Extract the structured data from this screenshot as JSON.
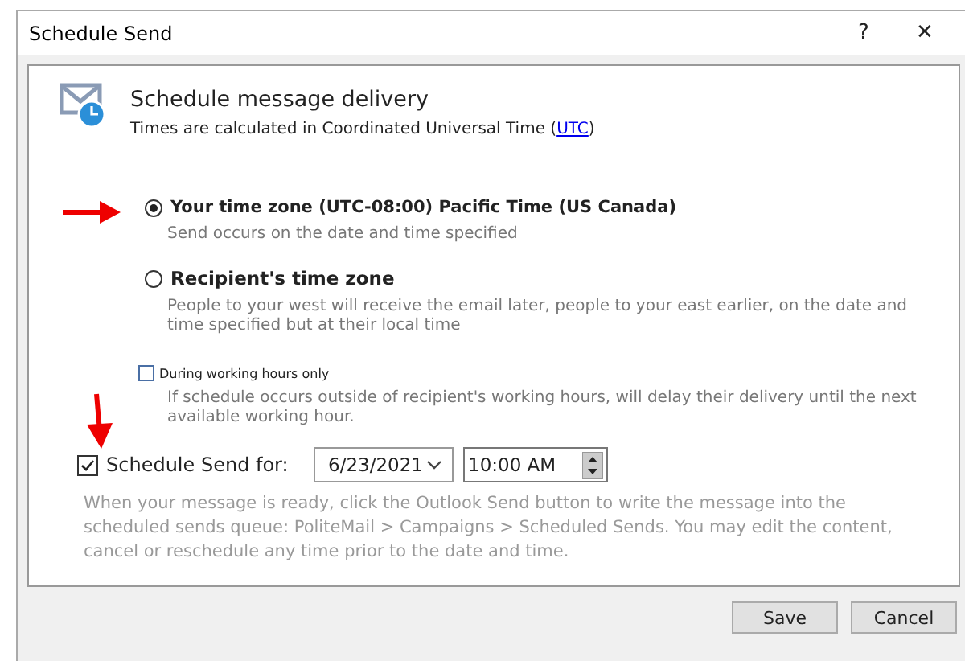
{
  "window": {
    "title": "Schedule Send",
    "help": "?",
    "close": "✕"
  },
  "header": {
    "title": "Schedule message delivery",
    "subtitle_before": "Times are calculated in Coordinated Universal Time (",
    "link": "UTC",
    "subtitle_after": ")"
  },
  "options": [
    {
      "label": "Your time zone (UTC-08:00) Pacific Time (US  Canada)",
      "selected": true,
      "hint": "Send occurs on the date and time specified"
    },
    {
      "label": "Recipient's time zone",
      "selected": false,
      "hint": "People to your west will receive the email later, people to your east earlier, on the date and time specified but at their local time"
    }
  ],
  "working_hours": {
    "label": "During working hours only",
    "checked": false,
    "hint": "If schedule occurs outside of recipient's working hours, will delay their delivery until the next available working hour."
  },
  "schedule": {
    "label": "Schedule Send for:",
    "checked": true,
    "date": "6/23/2021",
    "time": "10:00 AM",
    "note": "When your message is ready, click the Outlook Send button to write the message into the scheduled sends queue: PoliteMail > Campaigns > Scheduled Sends. You may edit the content, cancel or reschedule any time prior to the date and time."
  },
  "buttons": [
    "Save",
    "Cancel"
  ]
}
